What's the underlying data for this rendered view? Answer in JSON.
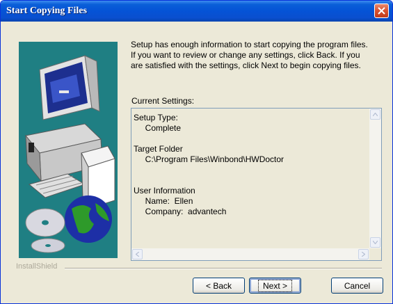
{
  "window": {
    "title": "Start Copying Files"
  },
  "intro_text": "Setup has enough information to start copying the program files.\nIf you want to review or change any settings, click Back.  If you\nare satisfied with the settings, click Next to begin copying files.",
  "settings": {
    "label": "Current Settings:",
    "text": "Setup Type:\n     Complete\n\nTarget Folder\n     C:\\Program Files\\Winbond\\HWDoctor\n\n\nUser Information\n     Name:  Ellen\n     Company:  advantech"
  },
  "brand": "InstallShield",
  "buttons": {
    "back": "< Back",
    "next": "Next >",
    "cancel": "Cancel"
  },
  "colors": {
    "titlebar": "#0553d6",
    "art_background": "#1f7f83",
    "close": "#d9502e"
  }
}
